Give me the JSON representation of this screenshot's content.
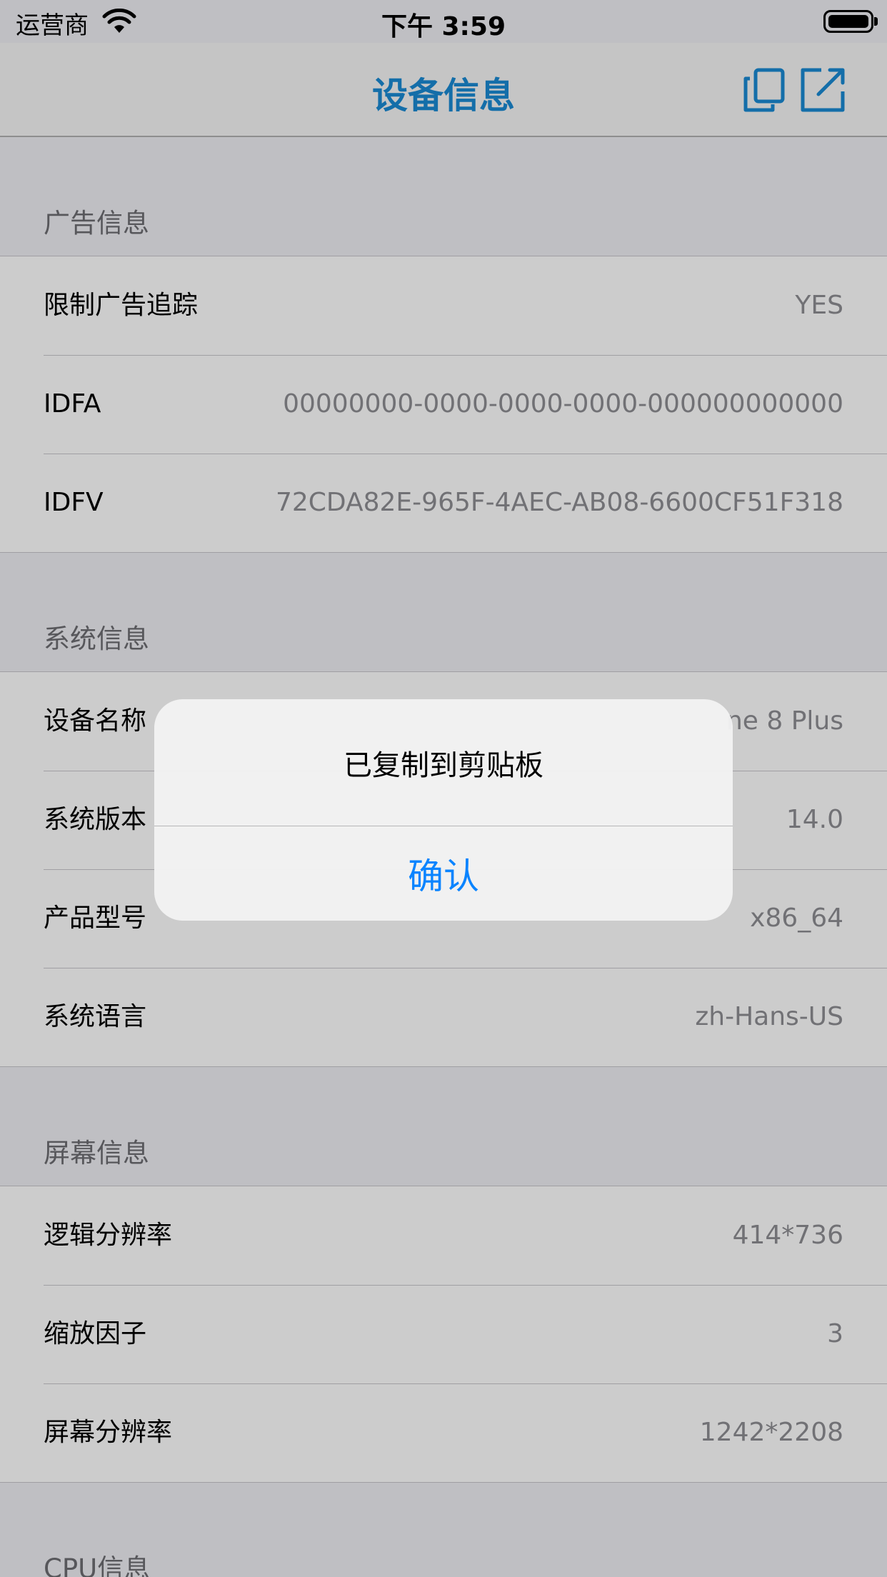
{
  "colors": {
    "accent": "#0a84ff",
    "title": "#1a8ad4"
  },
  "status_bar": {
    "carrier": "运营商",
    "time": "下午 3:59"
  },
  "nav": {
    "title": "设备信息",
    "copy_icon": "copy-icon",
    "share_icon": "share-icon"
  },
  "sections": {
    "ad": {
      "header": "广告信息",
      "rows": [
        {
          "label": "限制广告追踪",
          "value": "YES"
        },
        {
          "label": "IDFA",
          "value": "00000000-0000-0000-0000-000000000000"
        },
        {
          "label": "IDFV",
          "value": "72CDA82E-965F-4AEC-AB08-6600CF51F318"
        }
      ]
    },
    "system": {
      "header": "系统信息",
      "rows": [
        {
          "label": "设备名称",
          "value": "ne 8 Plus"
        },
        {
          "label": "系统版本",
          "value": "14.0"
        },
        {
          "label": "产品型号",
          "value": "x86_64"
        },
        {
          "label": "系统语言",
          "value": "zh-Hans-US"
        }
      ]
    },
    "screen": {
      "header": "屏幕信息",
      "rows": [
        {
          "label": "逻辑分辨率",
          "value": "414*736"
        },
        {
          "label": "缩放因子",
          "value": "3"
        },
        {
          "label": "屏幕分辨率",
          "value": "1242*2208"
        }
      ]
    },
    "cpu": {
      "header": "CPU信息"
    }
  },
  "alert": {
    "message": "已复制到剪贴板",
    "confirm": "确认"
  }
}
